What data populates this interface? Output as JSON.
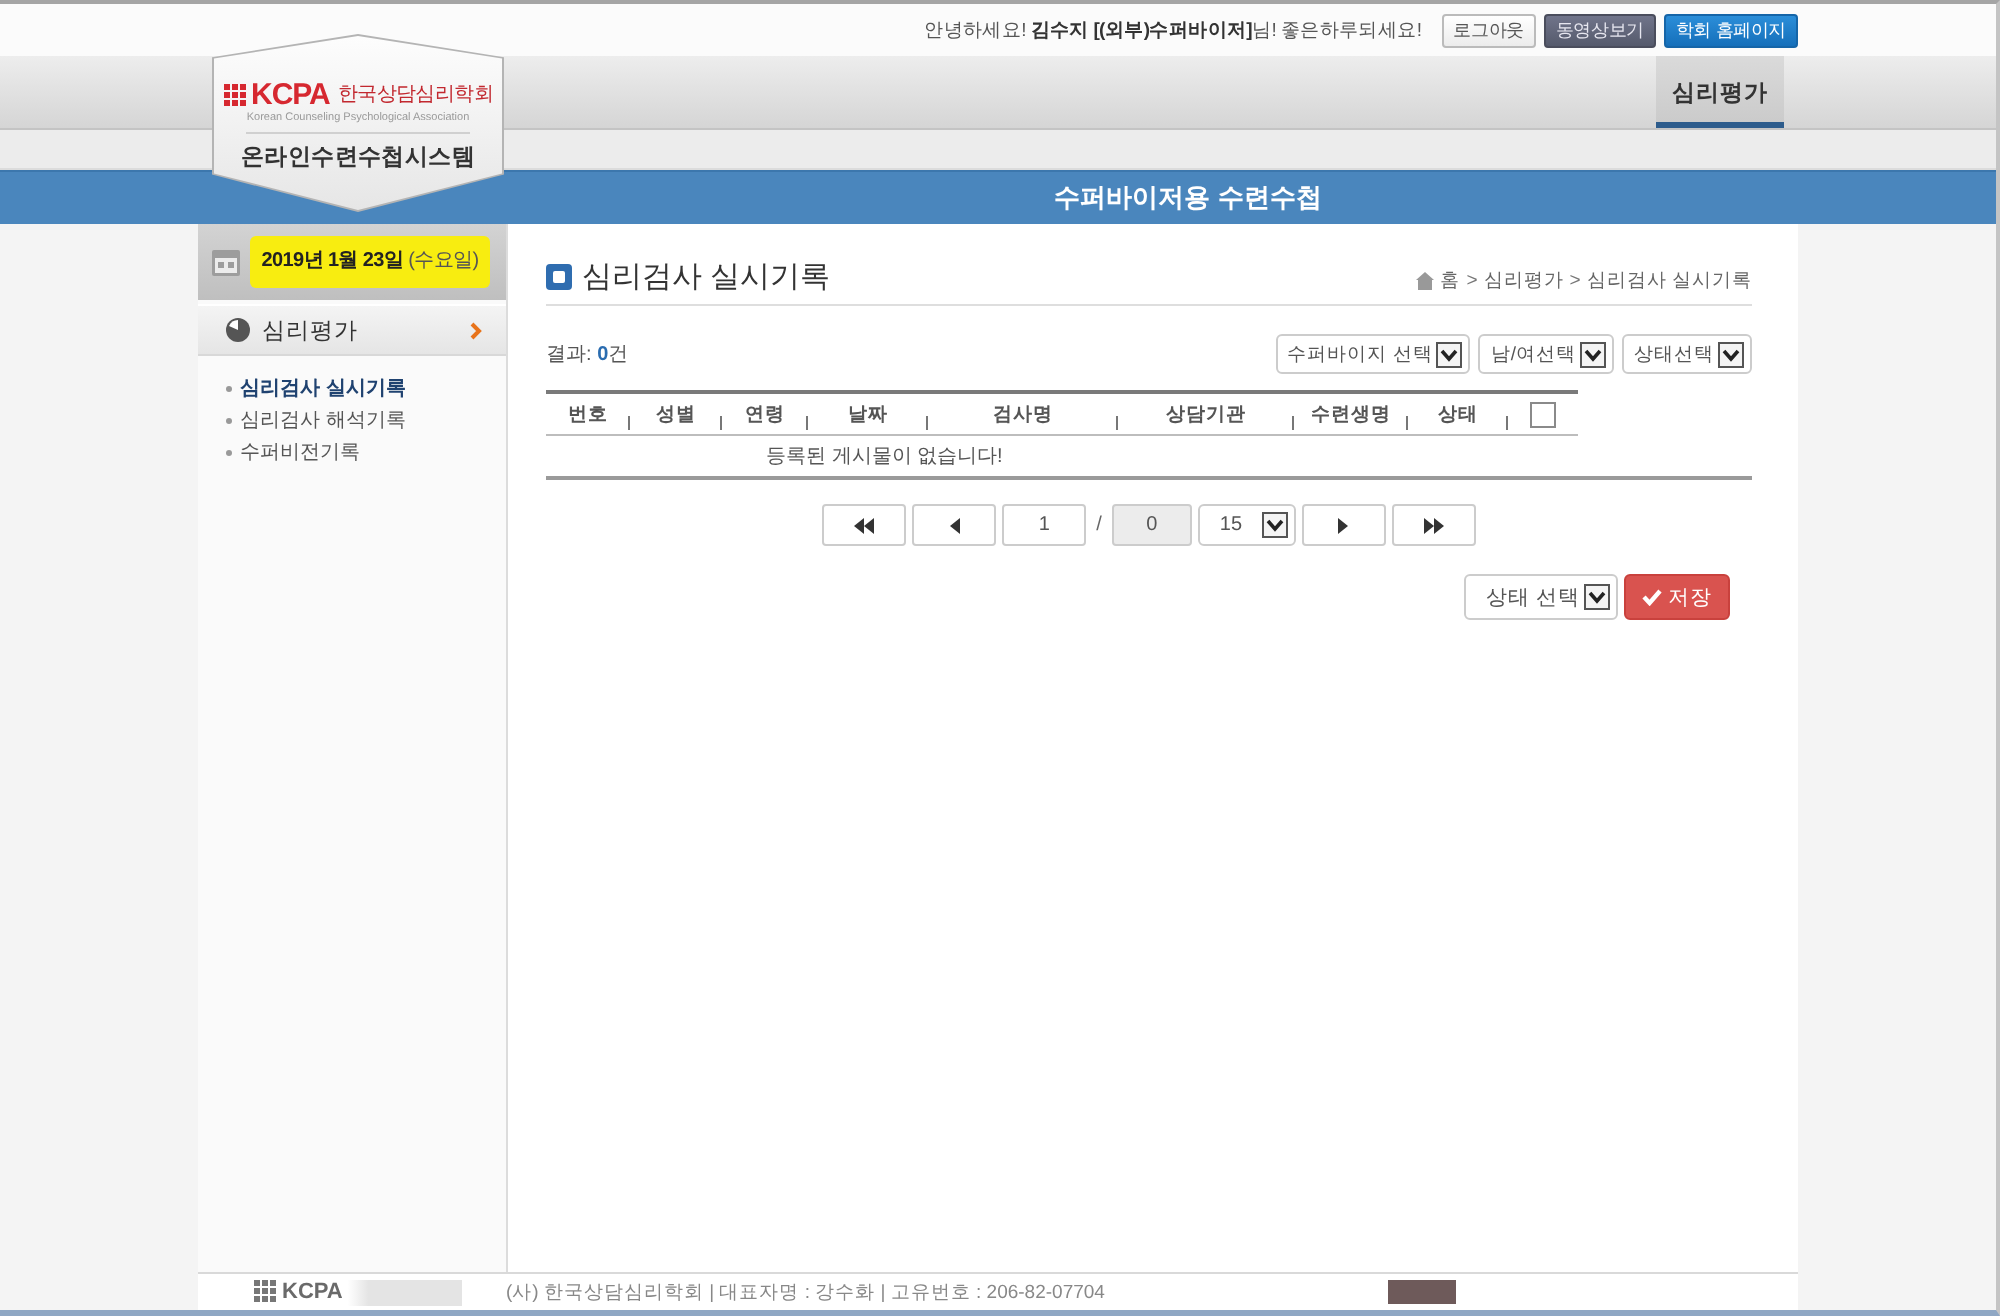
{
  "top_bar": {
    "greeting": "안녕하세요! **김수지 [(외부)수퍼바이저]**님! 좋은하루되세요!",
    "buttons": [
      {
        "label": "로그아웃",
        "kind": "plain"
      },
      {
        "label": "동영상보기",
        "kind": "dark"
      },
      {
        "label": "학회 홈페이지",
        "kind": "primary"
      }
    ]
  },
  "logo": {
    "mark": "KCPA",
    "society": "한국상담심리학회",
    "english": "Korean Counseling Psychological Association",
    "system": "온라인수련수첩시스템"
  },
  "nav": {
    "items": [
      {
        "label": "심리평가",
        "selected": true
      }
    ]
  },
  "banner": {
    "title": "수퍼바이저용 수련수첩"
  },
  "sidebar": {
    "date": "**2019년 1월 23일** (수요일)",
    "menu": {
      "label": "심리평가",
      "children": [
        {
          "label": "심리검사 실시기록",
          "selected": true
        },
        {
          "label": "심리검사 해석기록",
          "selected": false
        },
        {
          "label": "수퍼비전기록",
          "selected": false
        }
      ]
    }
  },
  "page": {
    "title": "심리검사 실시기록",
    "breadcrumb": {
      "items": [
        "홈",
        "심리평가",
        "심리검사 실시기록"
      ],
      "separator": ">"
    }
  },
  "result_count": "결과: **0**건",
  "filters": [
    {
      "label": "수퍼바이지 선택"
    },
    {
      "label": "남/여선택"
    },
    {
      "label": "상태선택"
    }
  ],
  "table": {
    "columns": [
      "번호",
      "성별",
      "연령",
      "날짜",
      "검사명",
      "상담기관",
      "수련생명",
      "상태"
    ],
    "select_all": {
      "checked": false
    },
    "empty_message": "등록된 게시물이 없습니다!"
  },
  "pagination": {
    "page": "1",
    "separator": "/",
    "total": "0",
    "page_size": "15"
  },
  "actions": {
    "status_select": "상태 선택",
    "save": "저장"
  },
  "footer": {
    "logo": "KCPA",
    "info": "(사) 한국상담심리학회 | 대표자명 : 강수화 | 고유번호 : 206-82-07704"
  }
}
